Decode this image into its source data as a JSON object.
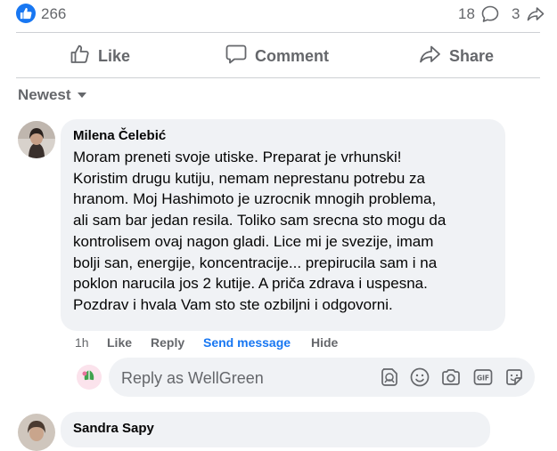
{
  "reactions": {
    "count": "266"
  },
  "stats": {
    "comments": "18",
    "shares": "3"
  },
  "actions": {
    "like": "Like",
    "comment": "Comment",
    "share": "Share"
  },
  "sort": {
    "label": "Newest"
  },
  "comment": {
    "author": "Milena Čelebić",
    "lines": [
      "Moram preneti svoje utiske. Preparat je vrhunski!",
      "Koristim drugu kutiju, nemam neprestanu potrebu za",
      "hranom. Moj Hashimoto je uzrocnik mnogih problema,",
      "ali sam bar jedan resila. Toliko sam srecna sto mogu da",
      "kontrolisem ovaj nagon gladi. Lice mi je svezije, imam",
      "bolji san, energije, koncentracije... prepirucila sam i na",
      "poklon narucila jos 2 kutije. A priča zdrava i uspesna.",
      "Pozdrav i hvala Vam sto ste ozbiljni i odgovorni."
    ],
    "time": "1h",
    "like": "Like",
    "reply": "Reply",
    "send_message": "Send message",
    "hide": "Hide"
  },
  "reply_box": {
    "placeholder": "Reply as WellGreen"
  },
  "next_comment": {
    "author": "Sandra Sapy"
  },
  "colors": {
    "accent": "#1877f2",
    "muted": "#65676b",
    "bubble": "#f0f2f5"
  }
}
